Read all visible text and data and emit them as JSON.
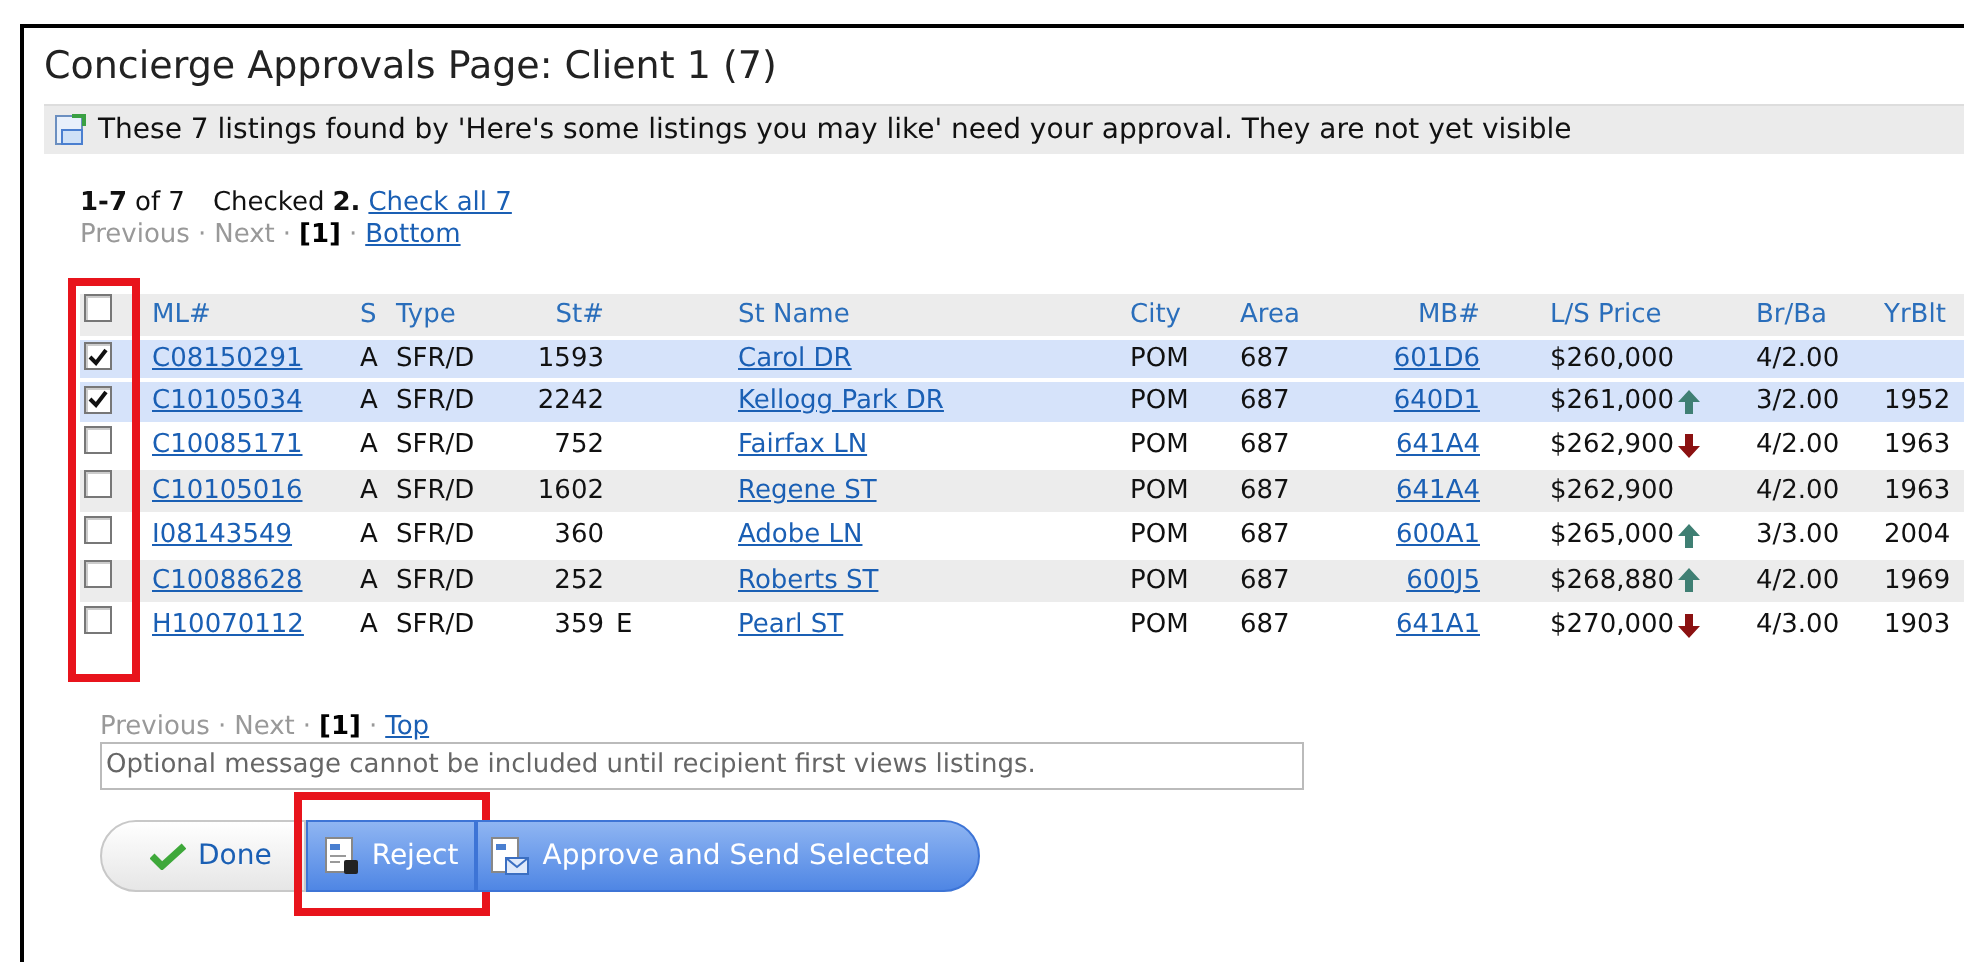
{
  "page": {
    "title": "Concierge Approvals Page: Client 1 (7)"
  },
  "notice": {
    "text": "These 7 listings found by 'Here's some listings you may like' need your approval. They are not yet visible"
  },
  "summary": {
    "range": "1-7",
    "of": "of 7",
    "checked_label": "Checked",
    "checked_count": "2.",
    "check_all": "Check all 7"
  },
  "pager_top": {
    "previous": "Previous",
    "sep": "·",
    "next": "Next",
    "page": "[1]",
    "jump": "Bottom"
  },
  "table": {
    "highlighted": true,
    "all_checked": false,
    "columns": [
      "ML#",
      "S",
      "Type",
      "St#",
      "St Name",
      "City",
      "Area",
      "MB#",
      "L/S Price",
      "Br/Ba",
      "YrBlt"
    ],
    "rows": [
      {
        "checked": true,
        "ml": "C08150291",
        "s": "A",
        "type": "SFR/D",
        "st_no": "1593",
        "st_name": "Carol DR",
        "city": "POM",
        "area": "687",
        "mb": "601D6",
        "price": "$260,000",
        "rising": false,
        "falling": false,
        "br_ba": "4/2.00"
      },
      {
        "checked": true,
        "ml": "C10105034",
        "s": "A",
        "type": "SFR/D",
        "st_no": "2242",
        "st_name": "Kellogg Park DR",
        "city": "POM",
        "area": "687",
        "mb": "640D1",
        "price": "$261,000",
        "rising": true,
        "falling": false,
        "br_ba": "3/2.00",
        "yr_blt": "1952"
      },
      {
        "checked": false,
        "ml": "C10085171",
        "s": "A",
        "type": "SFR/D",
        "st_no": "752",
        "st_name": "Fairfax LN",
        "city": "POM",
        "area": "687",
        "mb": "641A4",
        "price": "$262,900",
        "rising": false,
        "falling": true,
        "br_ba": "4/2.00",
        "yr_blt": "1963"
      },
      {
        "checked": false,
        "ml": "C10105016",
        "s": "A",
        "type": "SFR/D",
        "st_no": "1602",
        "st_name": "Regene ST",
        "city": "POM",
        "area": "687",
        "mb": "641A4",
        "price": "$262,900",
        "rising": false,
        "falling": false,
        "br_ba": "4/2.00",
        "yr_blt": "1963"
      },
      {
        "checked": false,
        "ml": "I08143549",
        "s": "A",
        "type": "SFR/D",
        "st_no": "360",
        "st_name": "Adobe LN",
        "city": "POM",
        "area": "687",
        "mb": "600A1",
        "price": "$265,000",
        "rising": true,
        "falling": false,
        "br_ba": "3/3.00",
        "yr_blt": "2004"
      },
      {
        "checked": false,
        "ml": "C10088628",
        "s": "A",
        "type": "SFR/D",
        "st_no": "252",
        "st_name": "Roberts ST",
        "city": "POM",
        "area": "687",
        "mb": "600J5",
        "price": "$268,880",
        "rising": true,
        "falling": false,
        "br_ba": "4/2.00",
        "yr_blt": "1969"
      },
      {
        "checked": false,
        "ml": "H10070112",
        "s": "A",
        "type": "SFR/D",
        "st_no": "359",
        "dir": "E",
        "st_name": "Pearl ST",
        "city": "POM",
        "area": "687",
        "mb": "641A1",
        "price": "$270,000",
        "rising": false,
        "falling": true,
        "br_ba": "4/3.00",
        "yr_blt": "1903"
      }
    ]
  },
  "pager_bottom": {
    "previous": "Previous",
    "sep": "·",
    "next": "Next",
    "page": "[1]",
    "jump": "Top"
  },
  "message": {
    "placeholder": "Optional message cannot be included until recipient first views listings."
  },
  "buttons": [
    {
      "kind": "done",
      "label": "Done",
      "highlighted": false
    },
    {
      "kind": "reject",
      "label": "Reject",
      "highlighted": true
    },
    {
      "kind": "approve",
      "label": "Approve and Send Selected",
      "highlighted": false
    }
  ]
}
